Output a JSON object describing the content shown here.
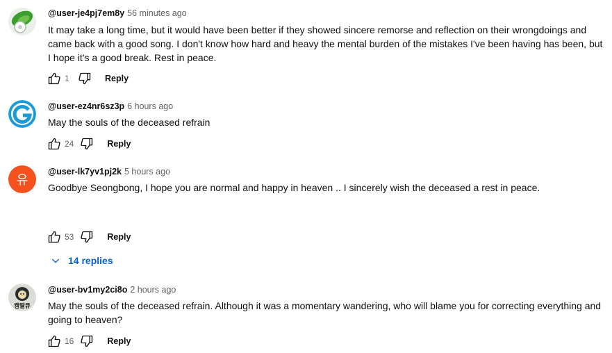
{
  "comments": [
    {
      "avatar_icon": "green-leaf-avatar-icon",
      "handle": "@user-je4pj7em8y",
      "time": "56 minutes ago",
      "text": "It may take a long time, but it would have been better if they showed sincere remorse and reflection on their wrongdoings and came back with a good song. I don't know how hard and heavy the mental burden of the mistakes I've been having has been, but I hope it's a good break. Rest in peace.",
      "likes": "1",
      "reply_label": "Reply"
    },
    {
      "avatar_icon": "letter-g-avatar-icon",
      "avatar_color": "#1a9ad6",
      "handle": "@user-ez4nr6sz3p",
      "time": "6 hours ago",
      "text": "May the souls of the deceased refrain",
      "likes": "24",
      "reply_label": "Reply"
    },
    {
      "avatar_icon": "letter-avatar-icon",
      "avatar_letter": "유",
      "avatar_color": "#f4511e",
      "handle": "@user-lk7yv1pj2k",
      "time": "5 hours ago",
      "text": "Goodbye Seongbong, I hope you are normal and happy in heaven .. I sincerely wish the deceased a rest in peace.",
      "likes": "53",
      "reply_label": "Reply",
      "replies_label": "14 replies"
    },
    {
      "avatar_icon": "character-avatar-icon",
      "avatar_text": "캥딸큐",
      "handle": "@user-bv1my2ci8o",
      "time": "2 hours ago",
      "text": "May the souls of the deceased refrain. Although it was a momentary wandering, who will blame you for correcting everything and going to heaven?",
      "likes": "16",
      "reply_label": "Reply"
    }
  ],
  "colors": {
    "link_blue": "#065fd4",
    "secondary_text": "#606060"
  }
}
